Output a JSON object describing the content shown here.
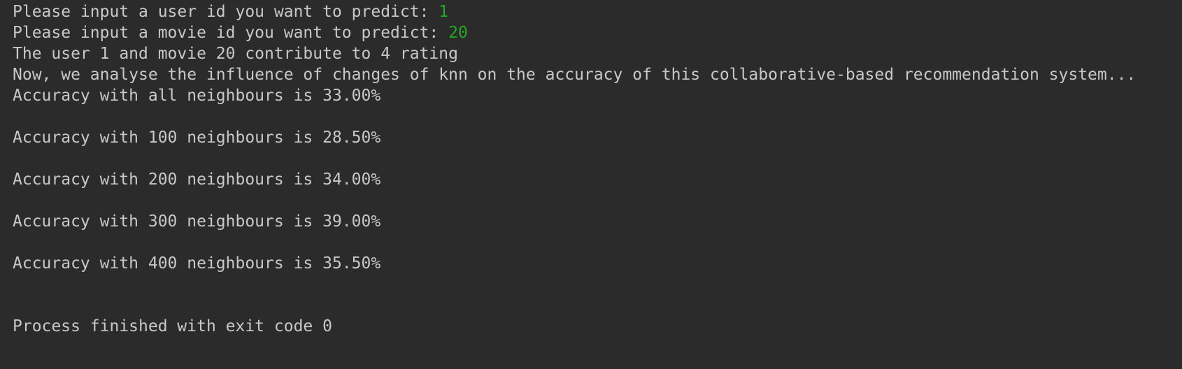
{
  "console": {
    "prompt_user": "Please input a user id you want to predict: ",
    "input_user": "1",
    "prompt_movie": "Please input a movie id you want to predict: ",
    "input_movie": "20",
    "rating_line": "The user 1 and movie 20 contribute to 4 rating",
    "analysis_line": "Now, we analyse the influence of changes of knn on the accuracy of this collaborative-based recommendation system...",
    "accuracy_lines": [
      "Accuracy with all neighbours is 33.00%",
      "Accuracy with 100 neighbours is 28.50%",
      "Accuracy with 200 neighbours is 34.00%",
      "Accuracy with 300 neighbours is 39.00%",
      "Accuracy with 400 neighbours is 35.50%"
    ],
    "exit_line": "Process finished with exit code 0"
  },
  "colors": {
    "background": "#2b2b2b",
    "text": "#c8c8c8",
    "user_input": "#22a722"
  }
}
